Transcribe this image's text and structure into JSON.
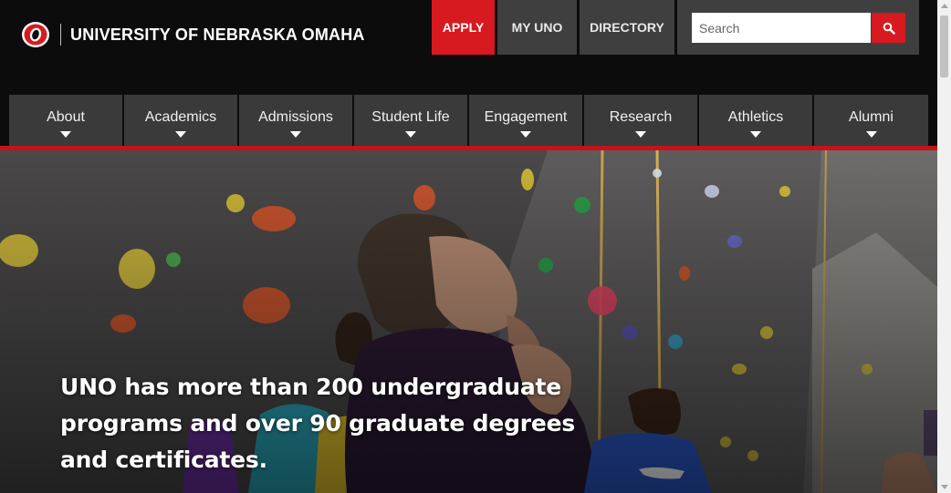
{
  "site": {
    "name": "UNIVERSITY OF NEBRASKA OMAHA",
    "logo_icon": "uno-o-logo"
  },
  "top_links": {
    "apply": "APPLY",
    "my_uno": "MY UNO",
    "directory": "DIRECTORY"
  },
  "search": {
    "placeholder": "Search",
    "icon": "search-icon"
  },
  "nav": {
    "items": [
      {
        "label": "About"
      },
      {
        "label": "Academics"
      },
      {
        "label": "Admissions"
      },
      {
        "label": "Student Life"
      },
      {
        "label": "Engagement"
      },
      {
        "label": "Research"
      },
      {
        "label": "Athletics"
      },
      {
        "label": "Alumni"
      }
    ]
  },
  "hero": {
    "caption": "UNO has more than 200 undergraduate programs and over 90 graduate degrees and certificates.",
    "image_subject": "student looking up at indoor climbing wall"
  },
  "colors": {
    "brand_red": "#d71920",
    "nav_rule": "#c4131a",
    "header_bg": "#0c0c0c",
    "nav_bg": "#3a3a3a"
  }
}
